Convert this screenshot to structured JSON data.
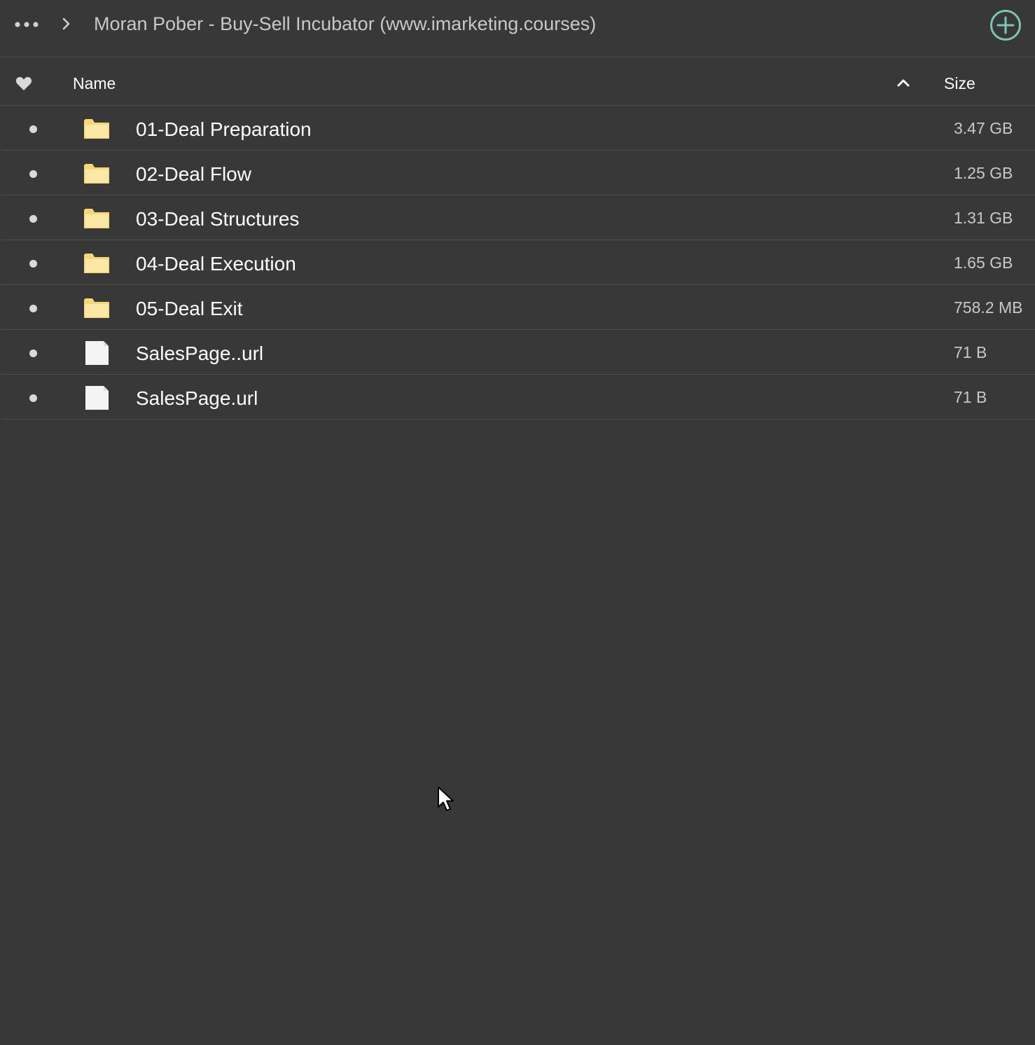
{
  "topbar": {
    "more_icon": "more-dots-icon",
    "separator_icon": "chevron-right-icon",
    "title": "Moran Pober - Buy-Sell Incubator (www.imarketing.courses)",
    "add_icon": "plus-circle-icon",
    "accent_color": "#7cc6b4"
  },
  "header": {
    "favorite_icon": "heart-icon",
    "name_label": "Name",
    "sort_icon": "chevron-up-icon",
    "size_label": "Size"
  },
  "files": [
    {
      "name": "01-Deal Preparation",
      "size": "3.47 GB",
      "type": "folder"
    },
    {
      "name": "02-Deal Flow",
      "size": "1.25 GB",
      "type": "folder"
    },
    {
      "name": "03-Deal Structures",
      "size": "1.31 GB",
      "type": "folder"
    },
    {
      "name": "04-Deal Execution",
      "size": "1.65 GB",
      "type": "folder"
    },
    {
      "name": "05-Deal Exit",
      "size": "758.2 MB",
      "type": "folder"
    },
    {
      "name": "SalesPage..url",
      "size": "71 B",
      "type": "file"
    },
    {
      "name": "SalesPage.url",
      "size": "71 B",
      "type": "file"
    }
  ],
  "colors": {
    "background": "#383838",
    "folder": "#f5d77a",
    "file": "#f4f4f4"
  }
}
